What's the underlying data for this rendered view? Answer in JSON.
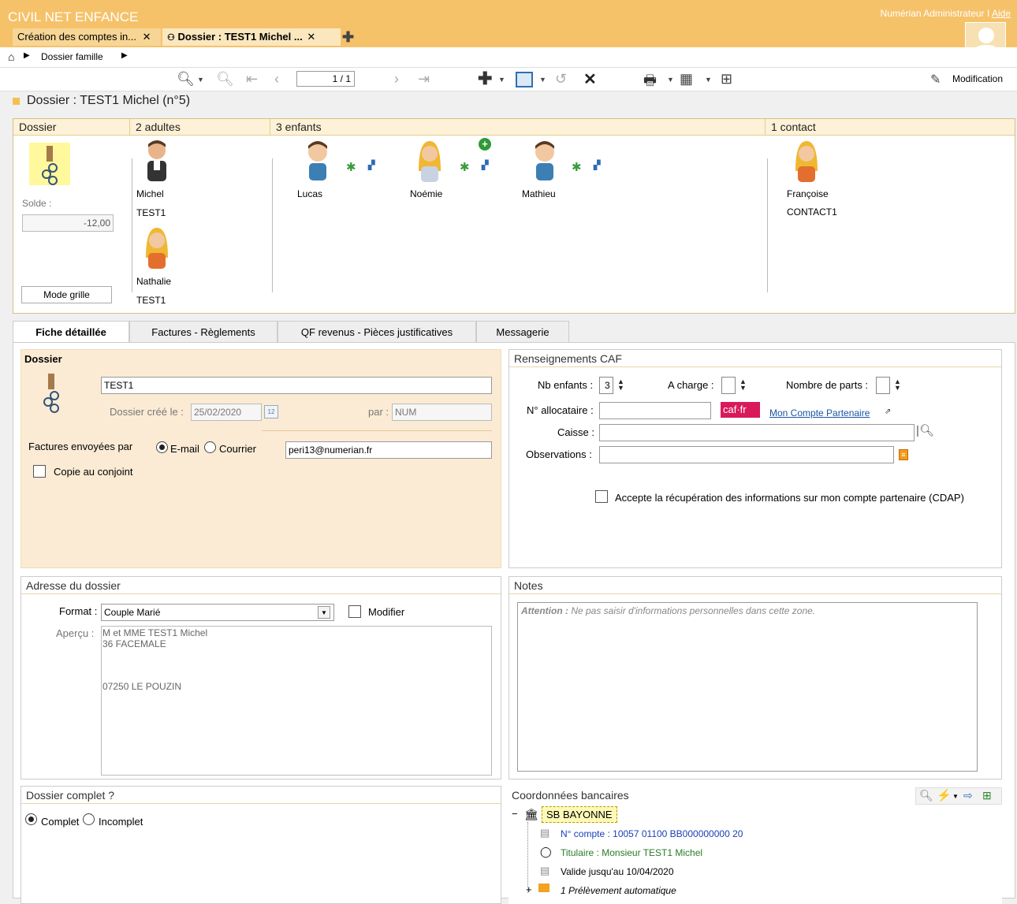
{
  "app": {
    "title": "CIVIL NET ENFANCE",
    "user": "Numérian Administrateur",
    "help": "Aide"
  },
  "top_tabs": [
    {
      "label": "Création des comptes in..."
    },
    {
      "label": "Dossier : TEST1 Michel ..."
    }
  ],
  "breadcrumb": {
    "item": "Dossier famille"
  },
  "toolbar": {
    "page_value": "1",
    "page_total": "/ 1",
    "mode_label": "Modification"
  },
  "page_title": "Dossier : TEST1 Michel (n°5)",
  "family": {
    "headers": [
      "Dossier",
      "2 adultes",
      "3 enfants",
      "1 contact"
    ],
    "solde_label": "Solde :",
    "solde_value": "-12,00",
    "mode_grille": "Mode grille",
    "adults": [
      {
        "first": "Michel",
        "last": "TEST1"
      },
      {
        "first": "Nathalie",
        "last": "TEST1"
      }
    ],
    "children": [
      {
        "first": "Lucas"
      },
      {
        "first": "Noémie"
      },
      {
        "first": "Mathieu"
      }
    ],
    "contact": {
      "first": "Françoise",
      "last": "CONTACT1"
    }
  },
  "tabs": [
    "Fiche détaillée",
    "Factures - Règlements",
    "QF revenus - Pièces justificatives",
    "Messagerie"
  ],
  "dossier": {
    "head": "Dossier",
    "name": "TEST1",
    "created_label": "Dossier créé le :",
    "created_value": "25/02/2020",
    "par_label": "par :",
    "par_value": "NUM",
    "factures_label": "Factures envoyées par",
    "email_label": "E-mail",
    "courrier_label": "Courrier",
    "email_value": "peri13@numerian.fr",
    "copie_label": "Copie au conjoint"
  },
  "caf": {
    "head": "Renseignements CAF",
    "nb_enfants_label": "Nb enfants :",
    "nb_enfants_value": "3",
    "a_charge_label": "A charge :",
    "nb_parts_label": "Nombre de parts :",
    "allocataire_label": "N° allocataire :",
    "caf_logo": "caf·fr",
    "compte_link": "Mon Compte Partenaire",
    "caisse_label": "Caisse :",
    "obs_label": "Observations :",
    "cdap_label": "Accepte la récupération des informations sur mon compte partenaire (CDAP)"
  },
  "adresse": {
    "head": "Adresse du dossier",
    "format_label": "Format :",
    "format_value": "Couple Marié",
    "modifier_label": "Modifier",
    "apercu_label": "Aperçu :",
    "lines": [
      "M et MME TEST1 Michel",
      "36 FACEMALE",
      "",
      "",
      "07250 LE POUZIN"
    ]
  },
  "notes": {
    "head": "Notes",
    "attention": "Attention :",
    "placeholder": "Ne pas saisir d'informations personnelles dans cette zone."
  },
  "complet": {
    "head": "Dossier complet ?",
    "complet": "Complet",
    "incomplet": "Incomplet"
  },
  "bank": {
    "head": "Coordonnées bancaires",
    "bank_name": "SB BAYONNE",
    "compte": "N° compte : 10057 01100 BB000000000 20",
    "titulaire": "Titulaire : Monsieur TEST1 Michel",
    "valide": "Valide jusqu'au 10/04/2020",
    "prelevement": "1 Prélèvement automatique"
  },
  "colors": {
    "header": "#f5c26a",
    "panel_bg": "#fbebd4",
    "accent_blue": "#1a55a8",
    "green_text": "#2a7a2a"
  }
}
